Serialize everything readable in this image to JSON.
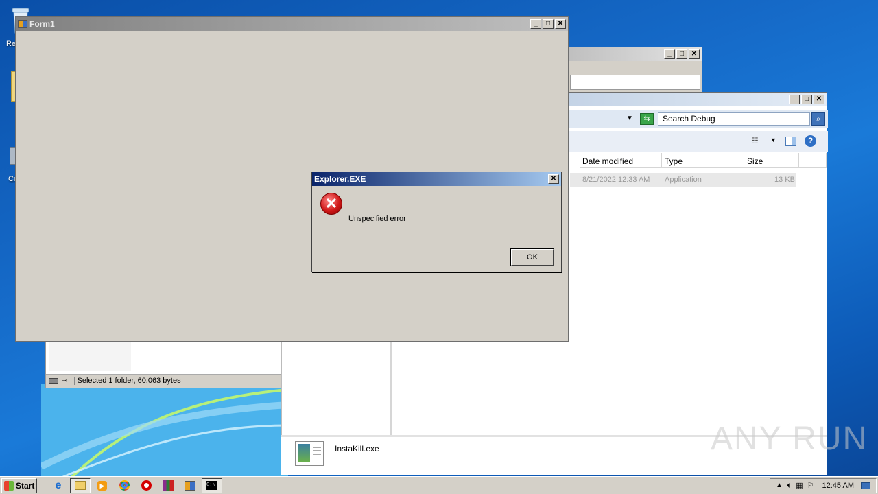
{
  "desktop": {
    "icons": [
      {
        "label": "Re"
      },
      {
        "label": "Co"
      }
    ]
  },
  "form1": {
    "title": "Form1"
  },
  "explorer": {
    "search_placeholder": "Search Debug",
    "columns": [
      "Date modified",
      "Type",
      "Size"
    ],
    "file": {
      "date": "8/21/2022 12:33 AM",
      "type": "Application",
      "size": "13 KB"
    },
    "details": {
      "filename": "InstaKill.exe"
    }
  },
  "tree_window": {
    "status": "Selected 1 folder, 60,063 bytes"
  },
  "dialog": {
    "title": "Explorer.EXE",
    "message": "Unspecified error",
    "ok_label": "OK"
  },
  "taskbar": {
    "start_label": "Start",
    "clock": "12:45 AM"
  },
  "watermark": "ANY RUN"
}
